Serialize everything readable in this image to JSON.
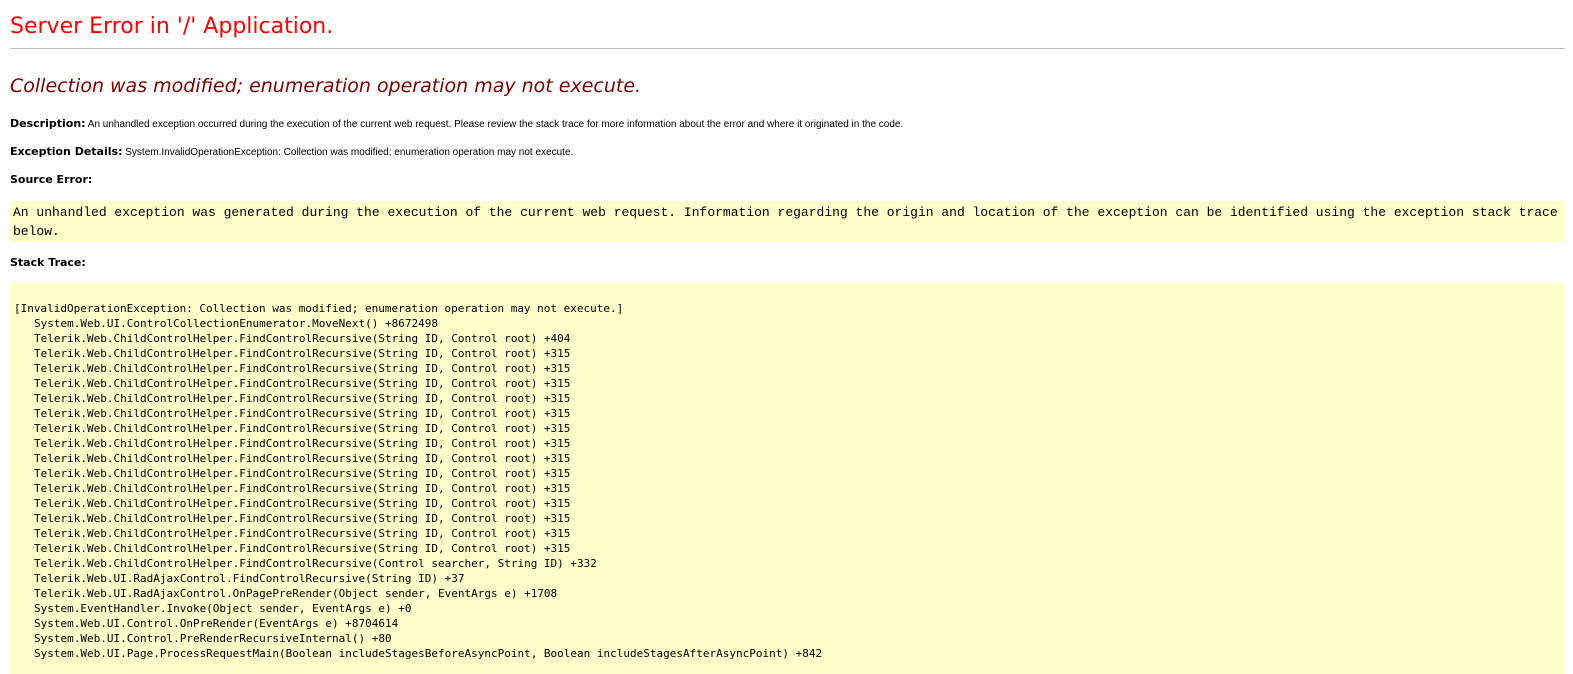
{
  "page": {
    "title": "Server Error in '/' Application.",
    "error_message": "Collection was modified; enumeration operation may not execute.",
    "description_label": "Description:",
    "description_text": "An unhandled exception occurred during the execution of the current web request. Please review the stack trace for more information about the error and where it originated in the code.",
    "exception_label": "Exception Details:",
    "exception_text": "System.InvalidOperationException: Collection was modified; enumeration operation may not execute.",
    "source_error_label": "Source Error:",
    "source_error_text": "An unhandled exception was generated during the execution of the current web request. Information regarding the origin and location of the exception can be identified using the exception stack trace below.",
    "stack_trace_label": "Stack Trace:"
  },
  "stack_trace": {
    "header": "[InvalidOperationException: Collection was modified; enumeration operation may not execute.]",
    "frames": [
      "System.Web.UI.ControlCollectionEnumerator.MoveNext() +8672498",
      "Telerik.Web.ChildControlHelper.FindControlRecursive(String ID, Control root) +404",
      "Telerik.Web.ChildControlHelper.FindControlRecursive(String ID, Control root) +315",
      "Telerik.Web.ChildControlHelper.FindControlRecursive(String ID, Control root) +315",
      "Telerik.Web.ChildControlHelper.FindControlRecursive(String ID, Control root) +315",
      "Telerik.Web.ChildControlHelper.FindControlRecursive(String ID, Control root) +315",
      "Telerik.Web.ChildControlHelper.FindControlRecursive(String ID, Control root) +315",
      "Telerik.Web.ChildControlHelper.FindControlRecursive(String ID, Control root) +315",
      "Telerik.Web.ChildControlHelper.FindControlRecursive(String ID, Control root) +315",
      "Telerik.Web.ChildControlHelper.FindControlRecursive(String ID, Control root) +315",
      "Telerik.Web.ChildControlHelper.FindControlRecursive(String ID, Control root) +315",
      "Telerik.Web.ChildControlHelper.FindControlRecursive(String ID, Control root) +315",
      "Telerik.Web.ChildControlHelper.FindControlRecursive(String ID, Control root) +315",
      "Telerik.Web.ChildControlHelper.FindControlRecursive(String ID, Control root) +315",
      "Telerik.Web.ChildControlHelper.FindControlRecursive(String ID, Control root) +315",
      "Telerik.Web.ChildControlHelper.FindControlRecursive(String ID, Control root) +315",
      "Telerik.Web.ChildControlHelper.FindControlRecursive(Control searcher, String ID) +332",
      "Telerik.Web.UI.RadAjaxControl.FindControlRecursive(String ID) +37",
      "Telerik.Web.UI.RadAjaxControl.OnPagePreRender(Object sender, EventArgs e) +1708",
      "System.EventHandler.Invoke(Object sender, EventArgs e) +0",
      "System.Web.UI.Control.OnPreRender(EventArgs e) +8704614",
      "System.Web.UI.Control.PreRenderRecursiveInternal() +80",
      "System.Web.UI.Page.ProcessRequestMain(Boolean includeStagesBeforeAsyncPoint, Boolean includeStagesAfterAsyncPoint) +842"
    ]
  },
  "colors": {
    "title": "#ff0000",
    "error_message": "#800000",
    "code_background": "#ffffcc",
    "rule": "#c0c0c0"
  }
}
